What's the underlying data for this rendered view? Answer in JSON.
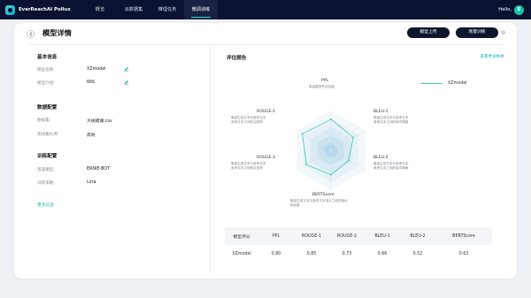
{
  "app": {
    "logo_text": "EverReachAI Pollux"
  },
  "nav": {
    "items": [
      "概览",
      "派数据集",
      "推理任务",
      "微调训练"
    ]
  },
  "user": {
    "greeting": "Hello,",
    "avatar_letter": "E"
  },
  "header": {
    "title": "模型详情",
    "upload_button": "模型上传",
    "train_button": "增量训练"
  },
  "basic_info": {
    "title": "基本信息",
    "fields": [
      {
        "label": "模型名称:",
        "value": "XZmodel"
      },
      {
        "label": "模型介绍:",
        "value": "666"
      }
    ]
  },
  "data_config": {
    "title": "数据配置",
    "fields": [
      {
        "label": "数据集:",
        "value": "大规模湖.csv"
      },
      {
        "label": "测试集比例:",
        "value": "高效"
      }
    ]
  },
  "train_config": {
    "title": "训练配置",
    "fields": [
      {
        "label": "基座模型:",
        "value": "ERNIE-BOT"
      },
      {
        "label": "训练策略:",
        "value": "Lora"
      }
    ]
  },
  "more_link": "更多信息",
  "evaluation": {
    "title": "评估报告",
    "view_more": "查看更多样本",
    "legend": "XZmodel",
    "axes": [
      {
        "label": "PPL",
        "desc": [
          "衡量模型的评估值"
        ]
      },
      {
        "label": "BLEU-1",
        "desc": [
          "衡量生成文本与参考文本",
          "参考文本之间的单词精度"
        ]
      },
      {
        "label": "BLEU-2",
        "desc": [
          "衡量生成文本与参考文本",
          "参考文本之间的双词精度"
        ]
      },
      {
        "label": "BERTScore",
        "desc": [
          "衡量生成文本与参考文本语义之间的相似",
          "相似度"
        ]
      },
      {
        "label": "ROUGE-2",
        "desc": [
          "衡量生成文本与参考文本",
          "参考文本之间的召回率"
        ]
      },
      {
        "label": "ROUGE-1",
        "desc": [
          "衡量生成文本与参考文本",
          "参考文本之间的召回率"
        ]
      }
    ]
  },
  "colors": {
    "accent": "#19b59d",
    "nav_bg": "#0b1130",
    "button_dark": "#10162f"
  },
  "chart_data": {
    "type": "radar",
    "axes": [
      "PPL",
      "BLEU-1",
      "BLEU-2",
      "BERTScore",
      "ROUGE-2",
      "ROUGE-1"
    ],
    "series": [
      {
        "name": "XZmodel",
        "values": [
          0.8,
          0.66,
          0.52,
          0.63,
          0.73,
          0.85
        ]
      }
    ],
    "range": [
      0,
      1
    ]
  },
  "table": {
    "headers": [
      "模型评分",
      "PPL",
      "ROUGE-1",
      "ROUGE-2",
      "BLEU-1",
      "BLEU-2",
      "BERTScore"
    ],
    "rows": [
      [
        "XZmodel",
        "0.80",
        "0.85",
        "0.73",
        "0.66",
        "0.52",
        "0.63"
      ]
    ]
  }
}
